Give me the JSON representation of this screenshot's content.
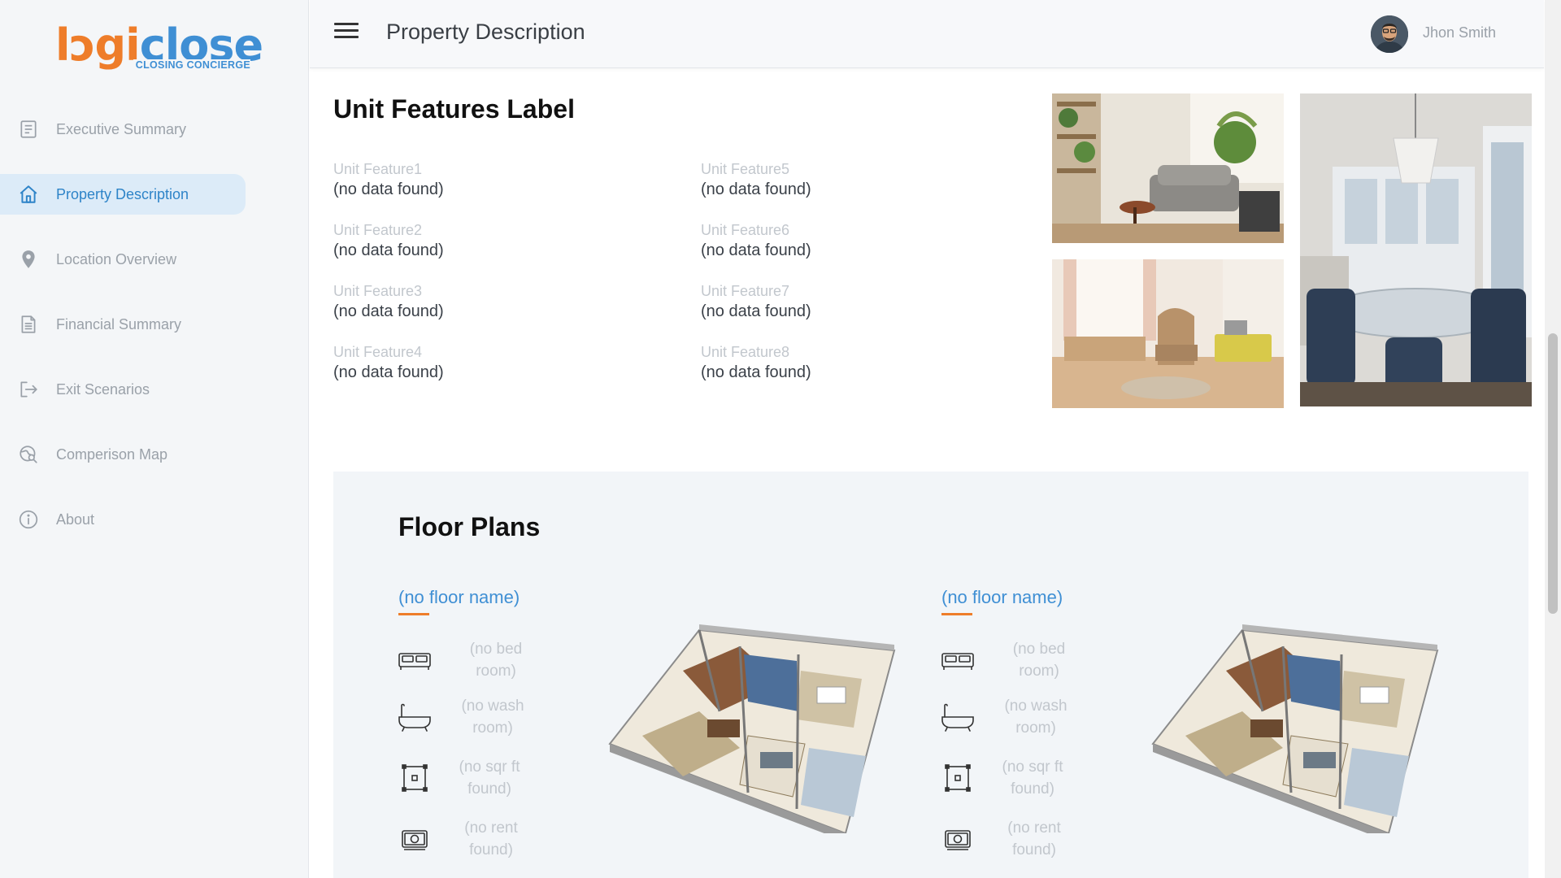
{
  "brand": {
    "logo_part1": "l",
    "logo_part2": "gi",
    "logo_part3": "close",
    "tagline": "CLOSING CONCIERGE"
  },
  "sidebar": {
    "items": [
      {
        "label": "Executive Summary",
        "icon": "document-list-icon"
      },
      {
        "label": "Property Description",
        "icon": "home-icon",
        "active": true
      },
      {
        "label": "Location Overview",
        "icon": "map-pin-icon"
      },
      {
        "label": "Financial Summary",
        "icon": "file-text-icon"
      },
      {
        "label": "Exit Scenarios",
        "icon": "logout-icon"
      },
      {
        "label": "Comperison Map",
        "icon": "map-search-icon"
      },
      {
        "label": "About",
        "icon": "info-icon"
      }
    ]
  },
  "header": {
    "title": "Property Description",
    "user_name": "Jhon Smith"
  },
  "unit_features": {
    "title": "Unit Features Label",
    "items": [
      {
        "label": "Unit Feature1",
        "value": "(no data found)"
      },
      {
        "label": "Unit Feature2",
        "value": "(no data found)"
      },
      {
        "label": "Unit Feature3",
        "value": "(no data found)"
      },
      {
        "label": "Unit Feature4",
        "value": "(no data found)"
      },
      {
        "label": "Unit Feature5",
        "value": "(no data found)"
      },
      {
        "label": "Unit Feature6",
        "value": "(no data found)"
      },
      {
        "label": "Unit Feature7",
        "value": "(no data found)"
      },
      {
        "label": "Unit Feature8",
        "value": "(no data found)"
      }
    ]
  },
  "floor_plans": {
    "title": "Floor Plans",
    "plans": [
      {
        "name": "(no floor name)",
        "bedroom_l1": "(no bed",
        "bedroom_l2": "room)",
        "washroom_l1": "(no wash",
        "washroom_l2": "room)",
        "sqft_l1": "(no sqr ft",
        "sqft_l2": "found)",
        "rent_l1": "(no rent",
        "rent_l2": "found)"
      },
      {
        "name": "(no floor name)",
        "bedroom_l1": "(no bed",
        "bedroom_l2": "room)",
        "washroom_l1": "(no wash",
        "washroom_l2": "room)",
        "sqft_l1": "(no sqr ft",
        "sqft_l2": "found)",
        "rent_l1": "(no rent",
        "rent_l2": "found)"
      }
    ]
  },
  "colors": {
    "accent_blue": "#3f8fd4",
    "accent_orange": "#ee7d2a",
    "active_bg": "#dcebf8"
  }
}
